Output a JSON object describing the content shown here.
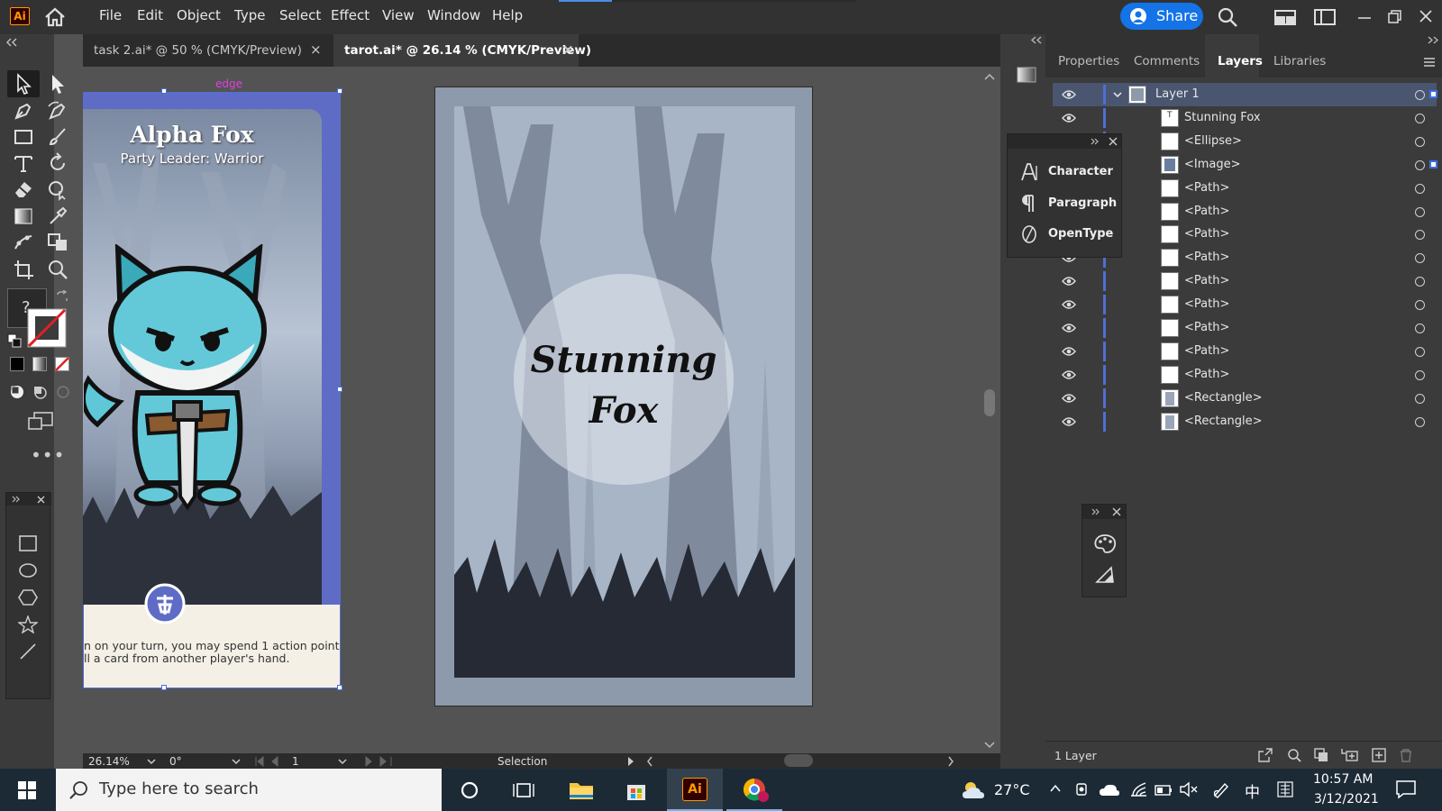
{
  "app": {
    "logo": "Ai",
    "share_label": "Share",
    "sync_progress_pct": 18
  },
  "menu": [
    "File",
    "Edit",
    "Object",
    "Type",
    "Select",
    "Effect",
    "View",
    "Window",
    "Help"
  ],
  "tabs": [
    {
      "label": "task 2.ai* @ 50 % (CMYK/Preview)",
      "close": "×"
    },
    {
      "label": "tarot.ai* @ 26.14 % (CMYK/Preview)",
      "close": "×"
    }
  ],
  "toolbar": {
    "help_glyph": "?"
  },
  "canvas": {
    "edge_label": "edge",
    "card_left": {
      "title": "Alpha Fox",
      "subtitle": "Party Leader: Warrior",
      "body_line1": "n on your turn, you may spend 1 action point",
      "body_line2": "ll a card from another player's hand."
    },
    "card_right": {
      "title_line1": "Stunning",
      "title_line2": "Fox"
    }
  },
  "status": {
    "zoom": "26.14%",
    "rotation": "0°",
    "artboard": "1",
    "tool": "Selection"
  },
  "panels": {
    "tabs": [
      "Properties",
      "Comments",
      "Layers",
      "Libraries"
    ],
    "active_tab": "Layers",
    "layers": [
      {
        "name": "Layer 1",
        "type": "layer"
      },
      {
        "name": "Stunning Fox",
        "type": "text"
      },
      {
        "name": "<Ellipse>",
        "type": "ellipse"
      },
      {
        "name": "<Image>",
        "type": "image"
      },
      {
        "name": "<Path>",
        "type": "path"
      },
      {
        "name": "<Path>",
        "type": "path"
      },
      {
        "name": "<Path>",
        "type": "path"
      },
      {
        "name": "<Path>",
        "type": "path"
      },
      {
        "name": "<Path>",
        "type": "path"
      },
      {
        "name": "<Path>",
        "type": "path"
      },
      {
        "name": "<Path>",
        "type": "path"
      },
      {
        "name": "<Path>",
        "type": "path"
      },
      {
        "name": "<Path>",
        "type": "path"
      },
      {
        "name": "<Rectangle>",
        "type": "rectangle"
      },
      {
        "name": "<Rectangle>",
        "type": "rectangle"
      }
    ],
    "layer_count": "1 Layer"
  },
  "type_panel": {
    "items": [
      "Character",
      "Paragraph",
      "OpenType"
    ]
  },
  "taskbar": {
    "search_placeholder": "Type here to search",
    "weather": "27°C",
    "ime": "中",
    "time": "10:57 AM",
    "date": "3/12/2021"
  },
  "colors": {
    "accent": "#1473e6",
    "selection": "#4f6fd6"
  }
}
